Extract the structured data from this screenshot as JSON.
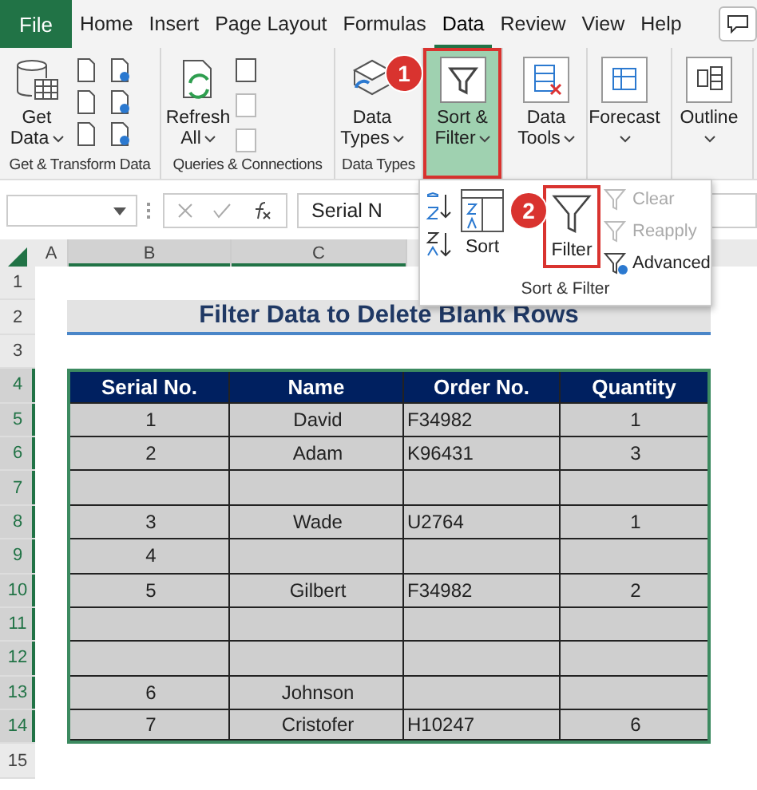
{
  "tabs": [
    {
      "label": "File",
      "kind": "file",
      "selected": false
    },
    {
      "label": "Home",
      "kind": "tab",
      "selected": false
    },
    {
      "label": "Insert",
      "kind": "tab",
      "selected": false
    },
    {
      "label": "Page Layout",
      "kind": "tab",
      "selected": false
    },
    {
      "label": "Formulas",
      "kind": "tab",
      "selected": false
    },
    {
      "label": "Data",
      "kind": "tab",
      "selected": true
    },
    {
      "label": "Review",
      "kind": "tab",
      "selected": false
    },
    {
      "label": "View",
      "kind": "tab",
      "selected": false
    },
    {
      "label": "Help",
      "kind": "tab",
      "selected": false
    }
  ],
  "ribbon": {
    "groups": [
      {
        "kind": "get",
        "label": "Get & Transform Data",
        "button": {
          "label": "Get Data",
          "dropdown": true,
          "selected": false
        }
      },
      {
        "kind": "queries",
        "label": "Queries & Connections",
        "button": {
          "label": "Refresh All",
          "dropdown": true,
          "selected": false
        }
      },
      {
        "kind": "types",
        "label": "Data Types",
        "button": {
          "label": "Data Types",
          "dropdown": true,
          "selected": false
        }
      },
      {
        "kind": "sort",
        "button": {
          "label": "Sort & Filter",
          "dropdown": true,
          "selected": true,
          "badge": "1"
        }
      },
      {
        "kind": "tools",
        "button": {
          "label": "Data Tools",
          "dropdown": true,
          "selected": false
        }
      },
      {
        "kind": "forecast",
        "button": {
          "label": "Forecast",
          "dropdown": true,
          "selected": false
        }
      },
      {
        "kind": "outline",
        "button": {
          "label": "Outline",
          "dropdown": true,
          "selected": false
        }
      }
    ]
  },
  "dropdown_panel": {
    "label": "Sort & Filter",
    "sort_button": {
      "label": "Sort"
    },
    "filter_button": {
      "label": "Filter",
      "selected": true,
      "badge": "2"
    },
    "options": [
      {
        "label": "Clear",
        "disabled": true
      },
      {
        "label": "Reapply",
        "disabled": true
      },
      {
        "label": "Advanced",
        "disabled": false
      }
    ]
  },
  "formula_bar": {
    "value": "Serial N"
  },
  "column_headers": [
    {
      "label": "A",
      "selected": false
    },
    {
      "label": "B",
      "selected": true
    },
    {
      "label": "C",
      "selected": true
    }
  ],
  "row_numbers": [
    {
      "label": "1",
      "selected": false
    },
    {
      "label": "2",
      "selected": false
    },
    {
      "label": "3",
      "selected": false
    },
    {
      "label": "4",
      "selected": true
    },
    {
      "label": "5",
      "selected": true
    },
    {
      "label": "6",
      "selected": true
    },
    {
      "label": "7",
      "selected": true
    },
    {
      "label": "8",
      "selected": true
    },
    {
      "label": "9",
      "selected": true
    },
    {
      "label": "10",
      "selected": true
    },
    {
      "label": "11",
      "selected": true
    },
    {
      "label": "12",
      "selected": true
    },
    {
      "label": "13",
      "selected": true
    },
    {
      "label": "14",
      "selected": true
    },
    {
      "label": "15",
      "selected": false
    }
  ],
  "sheet_title": "Filter Data to Delete Blank Rows",
  "table": {
    "columns": [
      {
        "label": "Serial No."
      },
      {
        "label": "Name"
      },
      {
        "label": "Order No."
      },
      {
        "label": "Quantity"
      }
    ],
    "rows": [
      {
        "serial_no": "1",
        "name": "David",
        "order_no": "F34982",
        "quantity": "1"
      },
      {
        "serial_no": "2",
        "name": "Adam",
        "order_no": "K96431",
        "quantity": "3"
      },
      {},
      {
        "serial_no": "3",
        "name": "Wade",
        "order_no": "U2764",
        "quantity": "1"
      },
      {
        "serial_no": "4"
      },
      {
        "serial_no": "5",
        "name": "Gilbert",
        "order_no": "F34982",
        "quantity": "2"
      },
      {},
      {},
      {
        "serial_no": "6",
        "name": "Johnson"
      },
      {
        "serial_no": "7",
        "name": "Cristofer",
        "order_no": "H10247",
        "quantity": "6"
      }
    ]
  }
}
